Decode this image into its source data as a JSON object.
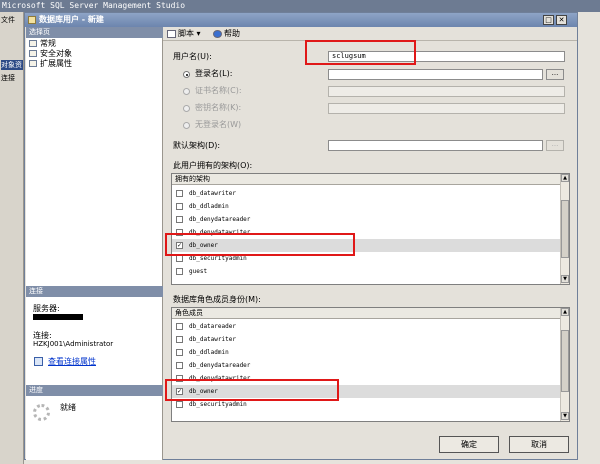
{
  "app": {
    "title": "Microsoft SQL Server Management Studio",
    "menu_file": "文件",
    "object_explorer": "对象资",
    "connect": "连接"
  },
  "dialog": {
    "title": "数据库用户 - 新建"
  },
  "left": {
    "select_page_header": "选择页",
    "pages": [
      {
        "label": "常规"
      },
      {
        "label": "安全对象"
      },
      {
        "label": "扩展属性"
      }
    ],
    "connection_header": "连接",
    "server_label": "服务器:",
    "connection_label": "连接:",
    "connection_value": "HZKJ001\\Administrator",
    "view_props_link": "查看连接属性",
    "progress_header": "进度",
    "progress_status": "就绪"
  },
  "toolbar": {
    "script": "脚本",
    "help": "帮助"
  },
  "form": {
    "username_label": "用户名(U):",
    "username_value": "sclugsum",
    "login_name_label": "登录名(L):",
    "cert_name_label": "证书名称(C):",
    "key_name_label": "密钥名称(K):",
    "no_login_label": "无登录名(W)",
    "default_schema_label": "默认架构(D):",
    "owned_schemas_label": "此用户拥有的架构(O):",
    "owned_schemas_header": "拥有的架构",
    "owned_schemas": [
      {
        "name": "db_datawriter",
        "checked": false
      },
      {
        "name": "db_ddladmin",
        "checked": false
      },
      {
        "name": "db_denydatareader",
        "checked": false
      },
      {
        "name": "db_denydatawriter",
        "checked": false
      },
      {
        "name": "db_owner",
        "checked": true
      },
      {
        "name": "db_securityadmin",
        "checked": false
      },
      {
        "name": "guest",
        "checked": false
      }
    ],
    "role_members_label": "数据库角色成员身份(M):",
    "role_members_header": "角色成员",
    "role_members": [
      {
        "name": "db_datareader",
        "checked": false
      },
      {
        "name": "db_datawriter",
        "checked": false
      },
      {
        "name": "db_ddladmin",
        "checked": false
      },
      {
        "name": "db_denydatareader",
        "checked": false
      },
      {
        "name": "db_denydatawriter",
        "checked": false
      },
      {
        "name": "db_owner",
        "checked": true
      },
      {
        "name": "db_securityadmin",
        "checked": false
      }
    ]
  },
  "buttons": {
    "ok": "确定",
    "cancel": "取消"
  },
  "colors": {
    "highlight": "#e01818",
    "selected_row": "#dcdcdc",
    "link": "#0033cc"
  }
}
